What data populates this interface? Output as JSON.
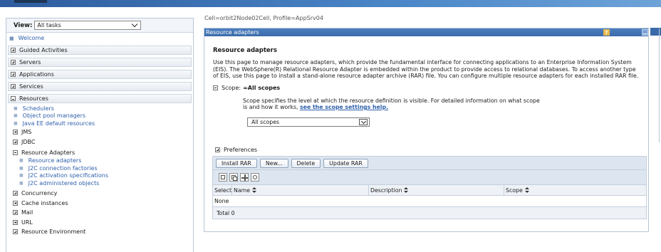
{
  "nav": {
    "view_label": "View:",
    "view_value": "All tasks",
    "welcome": "Welcome",
    "categories": [
      "Guided Activities",
      "Servers",
      "Applications",
      "Services"
    ],
    "resources": {
      "label": "Resources",
      "links": [
        "Schedulers",
        "Object pool managers",
        "Java EE default resources"
      ],
      "jms": "JMS",
      "jdbc": "JDBC",
      "resource_adapters": "Resource Adapters",
      "ra_links": [
        "Resource adapters",
        "J2C connection factories",
        "J2C activation specifications",
        "J2C administered objects"
      ],
      "groups": [
        "Concurrency",
        "Cache instances",
        "Mail",
        "URL",
        "Resource Environment"
      ]
    }
  },
  "main": {
    "breadcrumb": "Cell=orbit2Node02Cell, Profile=AppSrv04",
    "panel_title": "Resource adapters",
    "help_label": "?",
    "heading": "Resource adapters",
    "description": "Use this page to manage resource adapters, which provide the fundamental interface for connecting applications to an Enterprise Information System (EIS). The WebSphere(R) Relational Resource Adapter is embedded within the product to provide access to relational databases. To access another type of EIS, use this page to install a stand-alone resource adapter archive (RAR) file. You can configure multiple resource adapters for each installed RAR file.",
    "scope_label": "Scope:",
    "scope_value": "=All scopes",
    "scope_desc_1": "Scope specifies the level at which the resource definition is visible. For detailed information on what scope is and how it works,",
    "scope_link": "see the scope settings help.",
    "scope_select": "All scopes",
    "preferences": "Preferences",
    "buttons": [
      "Install RAR",
      "New...",
      "Delete",
      "Update RAR"
    ],
    "columns": [
      "Select",
      "Name",
      "Description",
      "Scope"
    ],
    "empty_row": "None",
    "total": "Total 0"
  }
}
